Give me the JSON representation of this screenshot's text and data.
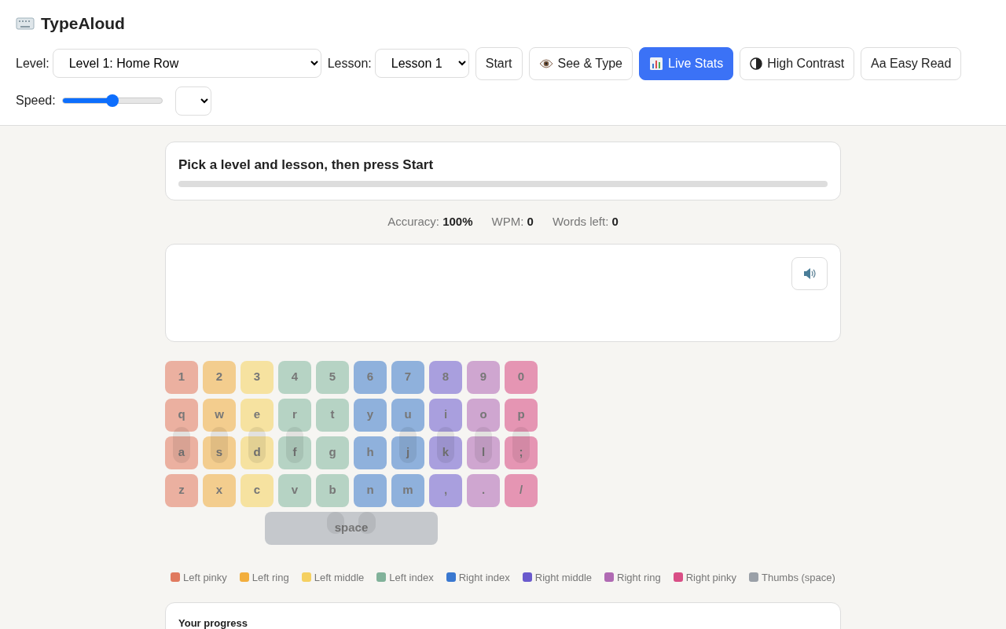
{
  "app": {
    "title": "TypeAloud"
  },
  "toolbar": {
    "level_label": "Level:",
    "level_value": "Level 1: Home Row",
    "lesson_label": "Lesson:",
    "lesson_value": "Lesson 1",
    "buttons": [
      {
        "label": "Start",
        "kind": "plain",
        "selected": false
      },
      {
        "label": "See & Type",
        "kind": "eye",
        "selected": false
      },
      {
        "label": "Live Stats",
        "kind": "chart",
        "selected": true
      },
      {
        "label": "High Contrast",
        "kind": "contrast",
        "selected": false
      },
      {
        "label": "Aa Easy Read",
        "kind": "plain",
        "selected": false
      }
    ],
    "speed_label": "Speed:",
    "speed": {
      "level": 0.5
    }
  },
  "prompt": {
    "text": "Pick a level and lesson, then press Start"
  },
  "stats": [
    {
      "label": "Accuracy:",
      "value": "100%"
    },
    {
      "label": "WPM:",
      "value": "0"
    },
    {
      "label": "Words left:",
      "value": "0"
    }
  ],
  "keyboard": {
    "rows": [
      [
        {
          "label": "1",
          "color": "#ebb0a0",
          "fingertip": false
        },
        {
          "label": "2",
          "color": "#f3cd8e",
          "fingertip": false
        },
        {
          "label": "3",
          "color": "#f6e2a0",
          "fingertip": false
        },
        {
          "label": "4",
          "color": "#b6d3c4",
          "fingertip": false
        },
        {
          "label": "5",
          "color": "#b6d3c4",
          "fingertip": false
        },
        {
          "label": "6",
          "color": "#8fb1dc",
          "fingertip": false
        },
        {
          "label": "7",
          "color": "#8fb1dc",
          "fingertip": false
        },
        {
          "label": "8",
          "color": "#a99fde",
          "fingertip": false
        },
        {
          "label": "9",
          "color": "#cfa6d0",
          "fingertip": false
        },
        {
          "label": "0",
          "color": "#e595b3",
          "fingertip": false
        }
      ],
      [
        {
          "label": "q",
          "color": "#ebb0a0",
          "fingertip": false
        },
        {
          "label": "w",
          "color": "#f3cd8e",
          "fingertip": false
        },
        {
          "label": "e",
          "color": "#f6e2a0",
          "fingertip": false
        },
        {
          "label": "r",
          "color": "#b6d3c4",
          "fingertip": false
        },
        {
          "label": "t",
          "color": "#b6d3c4",
          "fingertip": false
        },
        {
          "label": "y",
          "color": "#8fb1dc",
          "fingertip": false
        },
        {
          "label": "u",
          "color": "#8fb1dc",
          "fingertip": false
        },
        {
          "label": "i",
          "color": "#a99fde",
          "fingertip": false
        },
        {
          "label": "o",
          "color": "#cfa6d0",
          "fingertip": false
        },
        {
          "label": "p",
          "color": "#e595b3",
          "fingertip": false
        }
      ],
      [
        {
          "label": "a",
          "color": "#ebb0a0",
          "fingertip": true
        },
        {
          "label": "s",
          "color": "#f3cd8e",
          "fingertip": true
        },
        {
          "label": "d",
          "color": "#f6e2a0",
          "fingertip": true
        },
        {
          "label": "f",
          "color": "#b6d3c4",
          "fingertip": true
        },
        {
          "label": "g",
          "color": "#b6d3c4",
          "fingertip": false
        },
        {
          "label": "h",
          "color": "#8fb1dc",
          "fingertip": false
        },
        {
          "label": "j",
          "color": "#8fb1dc",
          "fingertip": true
        },
        {
          "label": "k",
          "color": "#a99fde",
          "fingertip": true
        },
        {
          "label": "l",
          "color": "#cfa6d0",
          "fingertip": true
        },
        {
          "label": ";",
          "color": "#e595b3",
          "fingertip": true
        }
      ],
      [
        {
          "label": "z",
          "color": "#ebb0a0",
          "fingertip": false
        },
        {
          "label": "x",
          "color": "#f3cd8e",
          "fingertip": false
        },
        {
          "label": "c",
          "color": "#f6e2a0",
          "fingertip": false
        },
        {
          "label": "v",
          "color": "#b6d3c4",
          "fingertip": false
        },
        {
          "label": "b",
          "color": "#b6d3c4",
          "fingertip": false
        },
        {
          "label": "n",
          "color": "#8fb1dc",
          "fingertip": false
        },
        {
          "label": "m",
          "color": "#8fb1dc",
          "fingertip": false
        },
        {
          "label": ",",
          "color": "#a99fde",
          "fingertip": false
        },
        {
          "label": ".",
          "color": "#cfa6d0",
          "fingertip": false
        },
        {
          "label": "/",
          "color": "#e595b3",
          "fingertip": false
        }
      ]
    ],
    "space": {
      "label": "space",
      "color": "#c5c8cc",
      "fingertip": true
    }
  },
  "legend": [
    {
      "label": "Left pinky",
      "color": "#e07a5f"
    },
    {
      "label": "Left ring",
      "color": "#f2ae3d"
    },
    {
      "label": "Left middle",
      "color": "#f5d061"
    },
    {
      "label": "Left index",
      "color": "#81b29a"
    },
    {
      "label": "Right index",
      "color": "#3a78d0"
    },
    {
      "label": "Right middle",
      "color": "#6a5acd"
    },
    {
      "label": "Right ring",
      "color": "#b06ab3"
    },
    {
      "label": "Right pinky",
      "color": "#d94f86"
    },
    {
      "label": "Thumbs (space)",
      "color": "#9aa0a8"
    }
  ],
  "progress_panel": {
    "title": "Your progress"
  }
}
